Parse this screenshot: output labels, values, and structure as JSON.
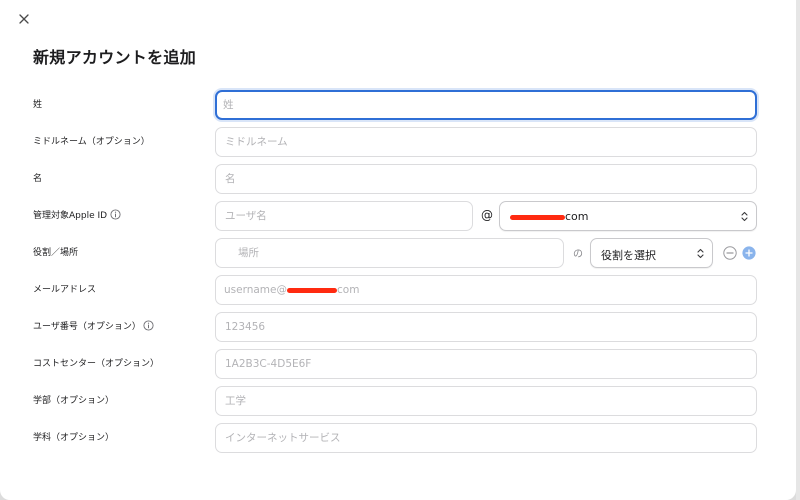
{
  "dialog": {
    "title": "新規アカウントを追加",
    "close_icon": "close-icon"
  },
  "form": {
    "last_name": {
      "label": "姓",
      "placeholder": "姓"
    },
    "middle_name": {
      "label": "ミドルネーム（オプション）",
      "placeholder": "ミドルネーム"
    },
    "first_name": {
      "label": "名",
      "placeholder": "名"
    },
    "managed_apple_id": {
      "label": "管理対象Apple ID",
      "info_icon": "info-icon",
      "username_placeholder": "ユーザ名",
      "at_sign": "@",
      "domain_suffix": "com",
      "domain_redacted": true
    },
    "role_location": {
      "label": "役割／場所",
      "location_placeholder": "場所",
      "connector": "の",
      "role_select": "役割を選択",
      "remove_icon": "minus-circle-icon",
      "add_icon": "plus-circle-icon"
    },
    "email": {
      "label": "メールアドレス",
      "placeholder_prefix": "username@",
      "placeholder_suffix": "com",
      "redacted": true
    },
    "user_number": {
      "label": "ユーザ番号（オプション）",
      "info_icon": "info-icon",
      "placeholder": "123456"
    },
    "cost_center": {
      "label": "コストセンター（オプション）",
      "placeholder": "1A2B3C-4D5E6F"
    },
    "department": {
      "label": "学部（オプション）",
      "placeholder": "工学"
    },
    "major": {
      "label": "学科（オプション）",
      "placeholder": "インターネットサービス"
    }
  },
  "colors": {
    "focus_ring": "#2f6fd6",
    "add_button": "#4a90e2",
    "redaction": "#ff2a10"
  }
}
